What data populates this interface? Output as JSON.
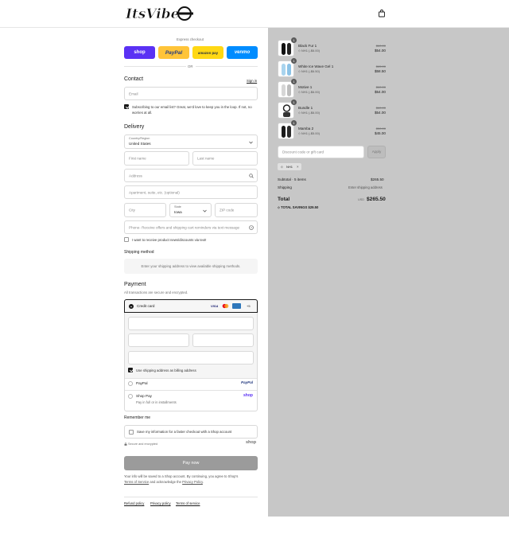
{
  "header": {
    "logo_text": "Itsvibe",
    "cart_icon": "shopping-bag-icon"
  },
  "express": {
    "title": "Express checkout",
    "buttons": [
      {
        "label": "shop",
        "color": "#5a31f4"
      },
      {
        "label": "PayPal",
        "color": "#ffc439"
      },
      {
        "label": "amazon pay",
        "color": "#ffd814"
      },
      {
        "label": "venmo",
        "color": "#008cff"
      }
    ],
    "or": "OR"
  },
  "contact": {
    "title": "Contact",
    "sign_in": "Sign in",
    "email_placeholder": "Email",
    "newsletter": "Subscribing to our email list? Great, we'd love to keep you in the loop. If not, no worries at all."
  },
  "delivery": {
    "title": "Delivery",
    "country_label": "Country/Region",
    "country_value": "United States",
    "first_name": "First name",
    "last_name": "Last name",
    "address": "Address",
    "apartment": "Apartment, suite, etc. (optional)",
    "city": "City",
    "state_label": "State",
    "state_value": "Iowa",
    "zip": "ZIP code",
    "phone": "Phone- Receive offers and shipping cart reminders via text message",
    "text_optin": "I want to receive product news/discounts via text!"
  },
  "shipping": {
    "title": "Shipping method",
    "message": "Enter your shipping address to view available shipping methods."
  },
  "payment": {
    "title": "Payment",
    "subtitle": "All transactions are secure and encrypted.",
    "credit_card": "Credit card",
    "card_more": "+5",
    "billing_same": "Use shipping address as billing address",
    "paypal": "PayPal",
    "shop_pay": "Shop Pay",
    "shop_pay_sub": "Pay in full or in installments"
  },
  "remember": {
    "title": "Remember me",
    "save_info": "Save my information for a faster checkout with a Shop account",
    "secure": "Secure and encrypted",
    "shop": "shop"
  },
  "pay_now": "Pay now",
  "legal": {
    "line1": "Your info will be saved to a Shop account. By continuing, you agree to Shop's",
    "terms": "Terms of Service",
    "and": "and acknowledge the",
    "privacy": "Privacy Policy",
    "dot": "."
  },
  "footer_links": [
    "Refund policy",
    "Privacy policy",
    "Terms of service"
  ],
  "cart": {
    "items": [
      {
        "qty": "1",
        "name": "Black Fur 1",
        "discount": "NH1 (-$6.00)",
        "original": "$60.00",
        "price": "$54.00"
      },
      {
        "qty": "1",
        "name": "White Ice Wave Gel 1",
        "discount": "NH1 (-$6.50)",
        "original": "$65.00",
        "price": "$58.50"
      },
      {
        "qty": "1",
        "name": "Motive 1",
        "discount": "NH1 (-$6.00)",
        "original": "$60.00",
        "price": "$54.00"
      },
      {
        "qty": "1",
        "name": "Bundle 1",
        "discount": "NH1 (-$6.00)",
        "original": "$60.00",
        "price": "$54.00"
      },
      {
        "qty": "1",
        "name": "Mamba 2",
        "discount": "NH1 (-$5.00)",
        "original": "$50.00",
        "price": "$45.00"
      }
    ],
    "discount_placeholder": "Discount code or gift card",
    "apply": "Apply",
    "code_chip": "NH1",
    "subtotal_label": "Subtotal · 5 items",
    "subtotal_value": "$265.50",
    "shipping_label": "Shipping",
    "shipping_value": "Enter shipping address",
    "total_label": "Total",
    "currency": "USD",
    "total_value": "$265.50",
    "savings": "TOTAL SAVINGS",
    "savings_value": "$29.50"
  }
}
